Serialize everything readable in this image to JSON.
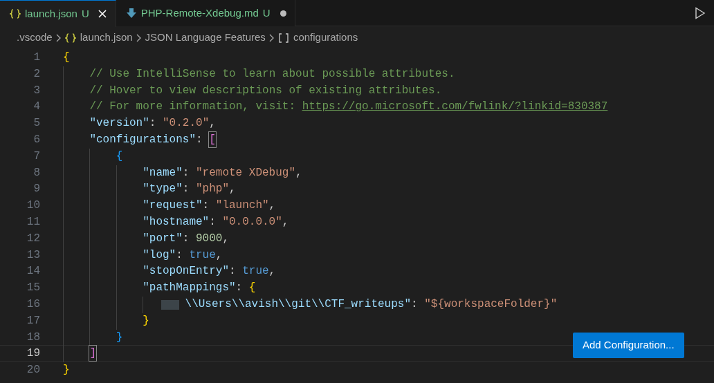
{
  "tabs": [
    {
      "label": "launch.json",
      "status": "U",
      "selected": true,
      "dirty": false
    },
    {
      "label": "PHP-Remote-Xdebug.md",
      "status": "U",
      "selected": false,
      "dirty": true
    }
  ],
  "breadcrumbs": [
    {
      "label": ".vscode"
    },
    {
      "label": "launch.json"
    },
    {
      "label": "JSON Language Features"
    },
    {
      "label": "configurations"
    }
  ],
  "editor": {
    "lines": [
      {
        "number": "1",
        "current": false,
        "tokens": [
          {
            "kind": "bracket",
            "text": "{",
            "color": "#ffd700",
            "matched": false
          }
        ]
      },
      {
        "number": "2",
        "current": false,
        "tokens": [
          {
            "kind": "comment",
            "text": "// Use IntelliSense to learn about possible attributes."
          }
        ]
      },
      {
        "number": "3",
        "current": false,
        "tokens": [
          {
            "kind": "comment",
            "text": "// Hover to view descriptions of existing attributes."
          }
        ]
      },
      {
        "number": "4",
        "current": false,
        "tokens": [
          {
            "kind": "comment",
            "text": "// For more information, visit: "
          },
          {
            "kind": "link",
            "text": "https://go.microsoft.com/fwlink/?linkid=830387"
          }
        ]
      },
      {
        "number": "5",
        "current": false,
        "tokens": [
          {
            "kind": "key",
            "text": "\"version\""
          },
          {
            "kind": "punct",
            "text": ": "
          },
          {
            "kind": "string",
            "text": "\"0.2.0\""
          },
          {
            "kind": "punct",
            "text": ","
          }
        ]
      },
      {
        "number": "6",
        "current": false,
        "tokens": [
          {
            "kind": "key",
            "text": "\"configurations\""
          },
          {
            "kind": "punct",
            "text": ": "
          },
          {
            "kind": "bracket",
            "text": "[",
            "color": "#da70d6",
            "matched": true
          }
        ]
      },
      {
        "number": "7",
        "current": false,
        "tokens": [
          {
            "kind": "bracket",
            "text": "{",
            "color": "#179fff",
            "matched": false
          }
        ]
      },
      {
        "number": "8",
        "current": false,
        "tokens": [
          {
            "kind": "key",
            "text": "\"name\""
          },
          {
            "kind": "punct",
            "text": ": "
          },
          {
            "kind": "string",
            "text": "\"remote XDebug\""
          },
          {
            "kind": "punct",
            "text": ","
          }
        ]
      },
      {
        "number": "9",
        "current": false,
        "tokens": [
          {
            "kind": "key",
            "text": "\"type\""
          },
          {
            "kind": "punct",
            "text": ": "
          },
          {
            "kind": "string",
            "text": "\"php\""
          },
          {
            "kind": "punct",
            "text": ","
          }
        ]
      },
      {
        "number": "10",
        "current": false,
        "tokens": [
          {
            "kind": "key",
            "text": "\"request\""
          },
          {
            "kind": "punct",
            "text": ": "
          },
          {
            "kind": "string",
            "text": "\"launch\""
          },
          {
            "kind": "punct",
            "text": ","
          }
        ]
      },
      {
        "number": "11",
        "current": false,
        "tokens": [
          {
            "kind": "key",
            "text": "\"hostname\""
          },
          {
            "kind": "punct",
            "text": ": "
          },
          {
            "kind": "string",
            "text": "\"0.0.0.0\""
          },
          {
            "kind": "punct",
            "text": ","
          }
        ]
      },
      {
        "number": "12",
        "current": false,
        "tokens": [
          {
            "kind": "key",
            "text": "\"port\""
          },
          {
            "kind": "punct",
            "text": ": "
          },
          {
            "kind": "number",
            "text": "9000"
          },
          {
            "kind": "punct",
            "text": ","
          }
        ]
      },
      {
        "number": "13",
        "current": false,
        "tokens": [
          {
            "kind": "key",
            "text": "\"log\""
          },
          {
            "kind": "punct",
            "text": ": "
          },
          {
            "kind": "bool",
            "text": "true"
          },
          {
            "kind": "punct",
            "text": ","
          }
        ]
      },
      {
        "number": "14",
        "current": false,
        "tokens": [
          {
            "kind": "key",
            "text": "\"stopOnEntry\""
          },
          {
            "kind": "punct",
            "text": ": "
          },
          {
            "kind": "bool",
            "text": "true"
          },
          {
            "kind": "punct",
            "text": ","
          }
        ]
      },
      {
        "number": "15",
        "current": false,
        "tokens": [
          {
            "kind": "key",
            "text": "\"pathMappings\""
          },
          {
            "kind": "punct",
            "text": ": "
          },
          {
            "kind": "bracket",
            "text": "{",
            "color": "#ffd700",
            "matched": false
          }
        ]
      },
      {
        "number": "16",
        "current": false,
        "tokens": [
          {
            "kind": "redacted"
          },
          {
            "kind": "key",
            "text": "\\\\Users\\\\avish\\\\git\\\\CTF_writeups\""
          },
          {
            "kind": "punct",
            "text": ": "
          },
          {
            "kind": "string",
            "text": "\"${workspaceFolder}\""
          }
        ]
      },
      {
        "number": "17",
        "current": false,
        "tokens": [
          {
            "kind": "bracket",
            "text": "}",
            "color": "#ffd700",
            "matched": false
          }
        ]
      },
      {
        "number": "18",
        "current": false,
        "tokens": [
          {
            "kind": "bracket",
            "text": "}",
            "color": "#179fff",
            "matched": false
          }
        ]
      },
      {
        "number": "19",
        "current": true,
        "tokens": [
          {
            "kind": "bracket",
            "text": "]",
            "color": "#da70d6",
            "matched": true
          }
        ]
      },
      {
        "number": "20",
        "current": false,
        "tokens": [
          {
            "kind": "bracket",
            "text": "}",
            "color": "#ffd700",
            "matched": false
          }
        ]
      }
    ]
  },
  "add_button": {
    "label": "Add Configuration..."
  }
}
